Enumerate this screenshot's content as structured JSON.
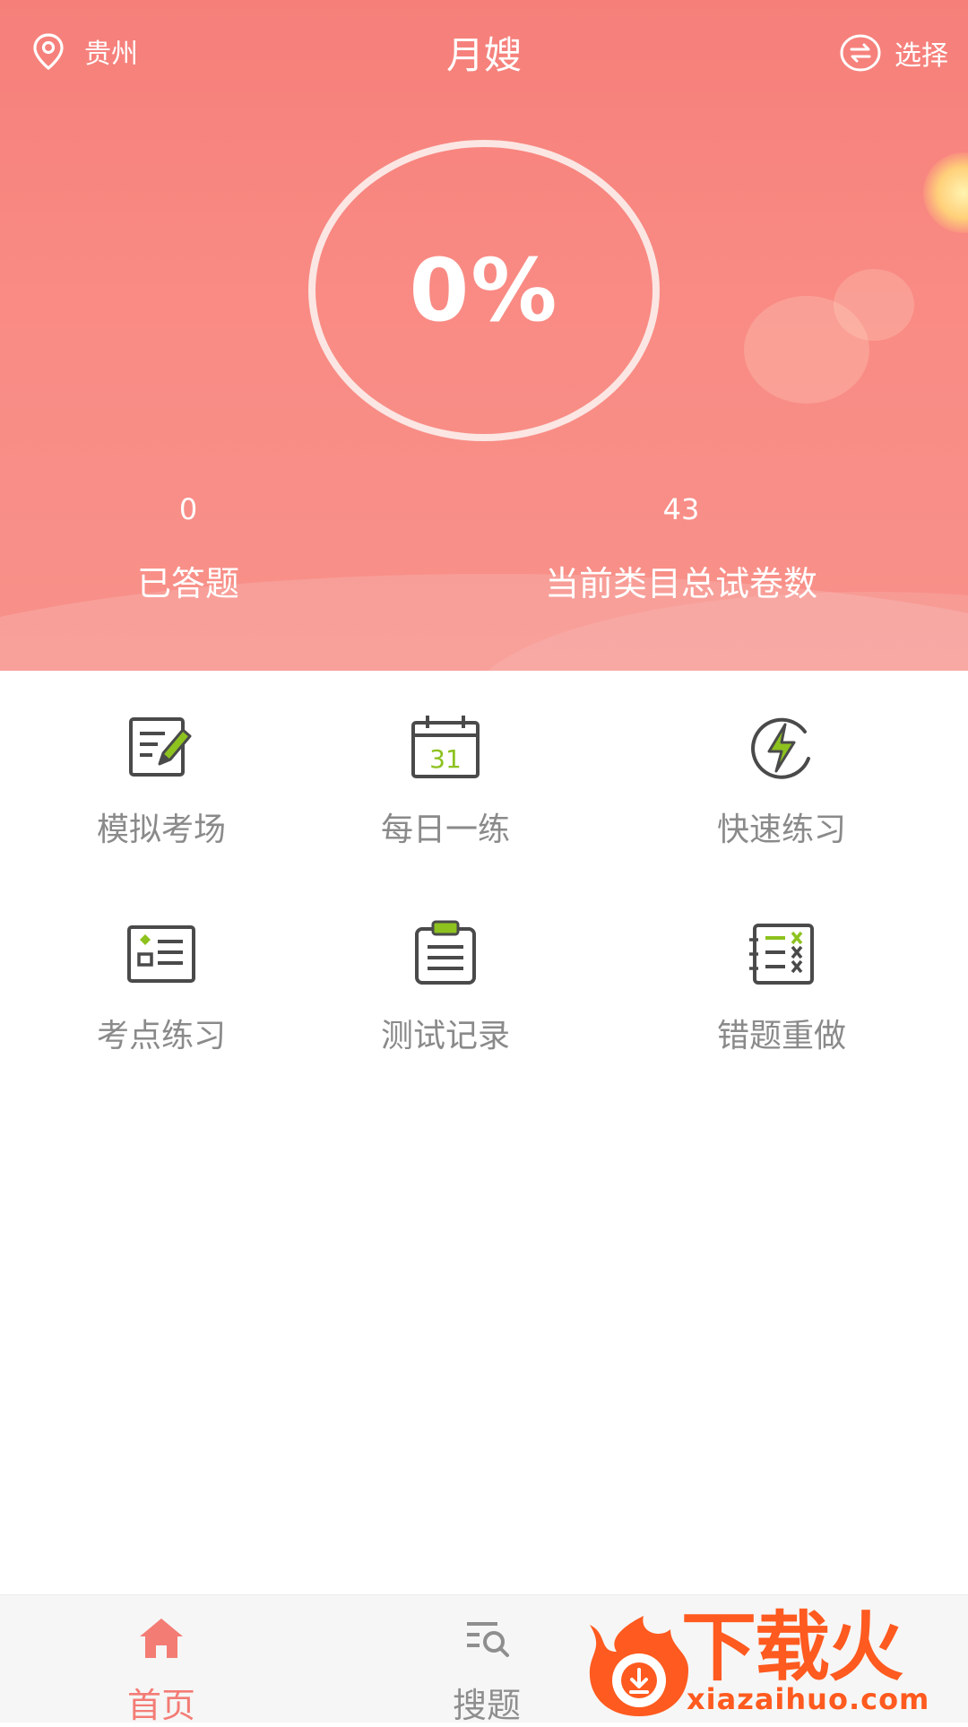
{
  "header": {
    "location": "贵州",
    "title": "月嫂",
    "switch_label": "选择"
  },
  "progress": {
    "percent_text": "0%",
    "percent_value": 0
  },
  "stats": {
    "answered": {
      "value": "0",
      "label": "已答题"
    },
    "total_papers": {
      "value": "43",
      "label": "当前类目总试卷数"
    }
  },
  "features": [
    {
      "label": "模拟考场",
      "icon": "edit-document-icon"
    },
    {
      "label": "每日一练",
      "icon": "calendar-icon"
    },
    {
      "label": "快速练习",
      "icon": "lightning-icon"
    },
    {
      "label": "考点练习",
      "icon": "checklist-card-icon"
    },
    {
      "label": "测试记录",
      "icon": "clipboard-icon"
    },
    {
      "label": "错题重做",
      "icon": "wrong-answers-icon"
    }
  ],
  "calendar_day": "31",
  "nav": {
    "home": "首页",
    "search": "搜题"
  },
  "watermark": {
    "title": "下载火",
    "url": "xiazaihuo.com"
  },
  "colors": {
    "primary": "#f67f7a",
    "accent_green": "#8dc21f",
    "icon_dark": "#4a4a4a",
    "watermark": "#ff5a1f"
  }
}
